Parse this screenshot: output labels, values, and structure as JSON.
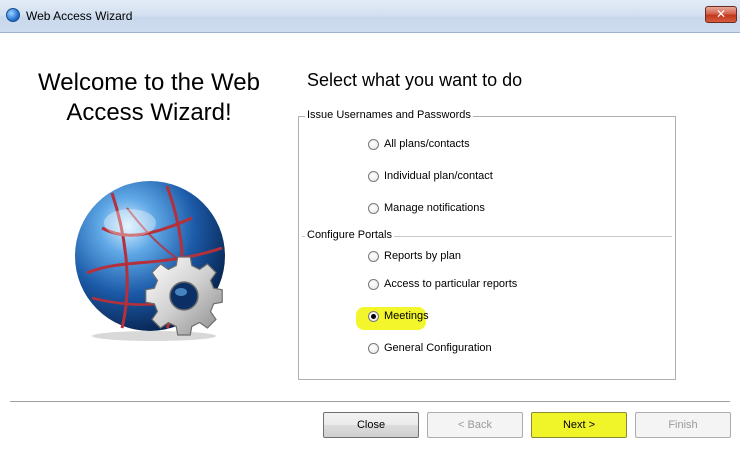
{
  "window": {
    "title": "Web Access Wizard",
    "close_glyph": "✕"
  },
  "left": {
    "welcome_line1": "Welcome to the Web",
    "welcome_line2": "Access Wizard!"
  },
  "main": {
    "heading": "Select what you want to do",
    "groups": [
      {
        "caption": "Issue Usernames and Passwords",
        "options": [
          {
            "label": "All plans/contacts",
            "checked": false
          },
          {
            "label": "Individual plan/contact",
            "checked": false
          },
          {
            "label": "Manage notifications",
            "checked": false
          }
        ]
      },
      {
        "caption": "Configure Portals",
        "options": [
          {
            "label": "Reports by plan",
            "checked": false
          },
          {
            "label": "Access to particular reports",
            "checked": false
          },
          {
            "label": "Meetings",
            "checked": true
          },
          {
            "label": "General Configuration",
            "checked": false
          }
        ]
      }
    ]
  },
  "buttons": {
    "close": "Close",
    "back": "< Back",
    "next": "Next >",
    "finish": "Finish"
  },
  "colors": {
    "highlight": "#f3f62a"
  }
}
